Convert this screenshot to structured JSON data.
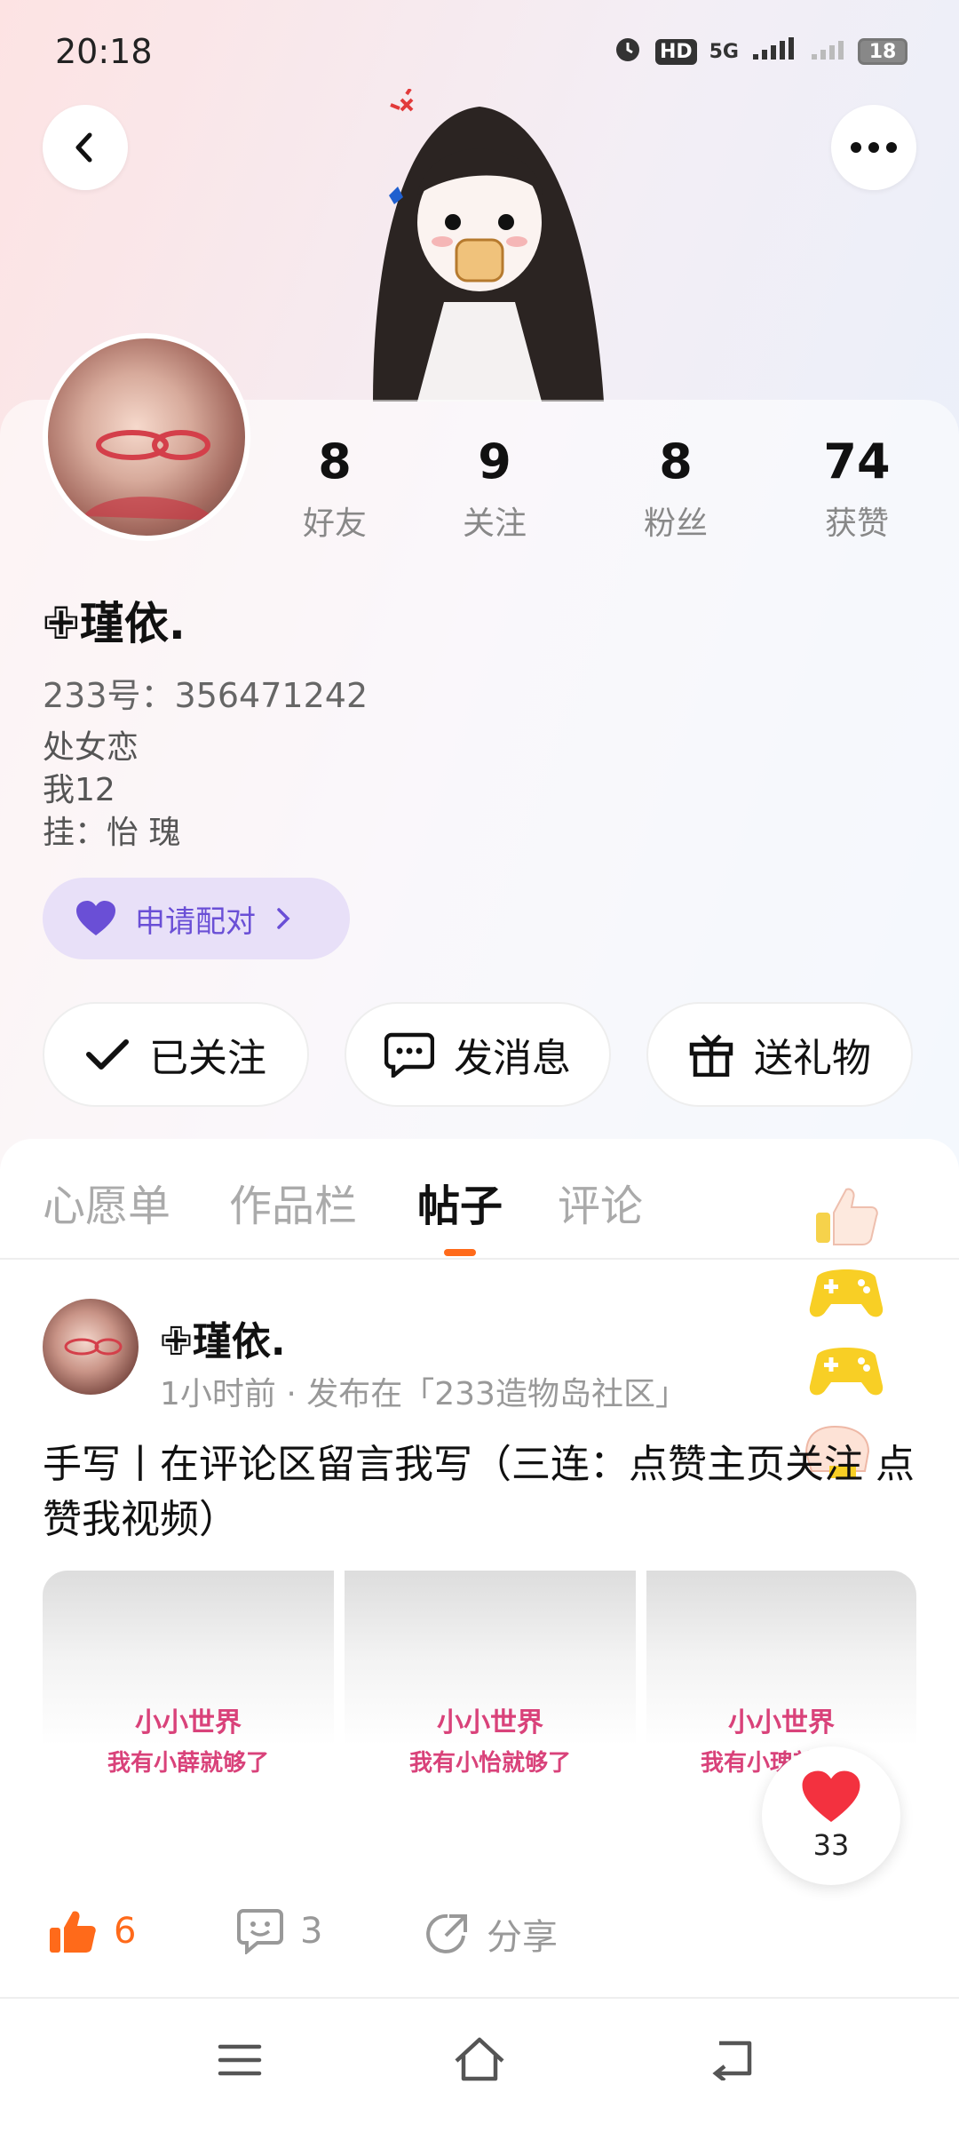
{
  "status": {
    "time": "20:18",
    "battery": "18",
    "network": "5G"
  },
  "stats": [
    {
      "num": "8",
      "label": "好友"
    },
    {
      "num": "9",
      "label": "关注"
    },
    {
      "num": "8",
      "label": "粉丝"
    },
    {
      "num": "74",
      "label": "获赞"
    }
  ],
  "profile": {
    "name": "✙瑾依.",
    "uid": "233号：356471242",
    "bio": [
      "处女恋",
      "我12",
      "挂：怡  瑰"
    ],
    "match_label": "申请配对"
  },
  "actions": {
    "follow": "已关注",
    "message": "发消息",
    "gift": "送礼物"
  },
  "tabs": [
    "心愿单",
    "作品栏",
    "帖子",
    "评论"
  ],
  "post": {
    "author": "✙瑾依.",
    "meta": "1小时前 · 发布在「233造物岛社区」",
    "text": "手写丨在评论区留言我写（三连：点赞主页关注 点赞我视频）",
    "thumbs": [
      {
        "line1": "小小世界",
        "line2": "我有小薛就够了"
      },
      {
        "line1": "小小世界",
        "line2": "我有小怡就够了"
      },
      {
        "line1": "小小世界",
        "line2": "我有小瑰就够了"
      }
    ],
    "likes": "6",
    "comments": "3",
    "share": "分享",
    "float_likes": "33"
  },
  "colors": {
    "accent": "#ff6a1a",
    "match": "#6a4fd6"
  }
}
